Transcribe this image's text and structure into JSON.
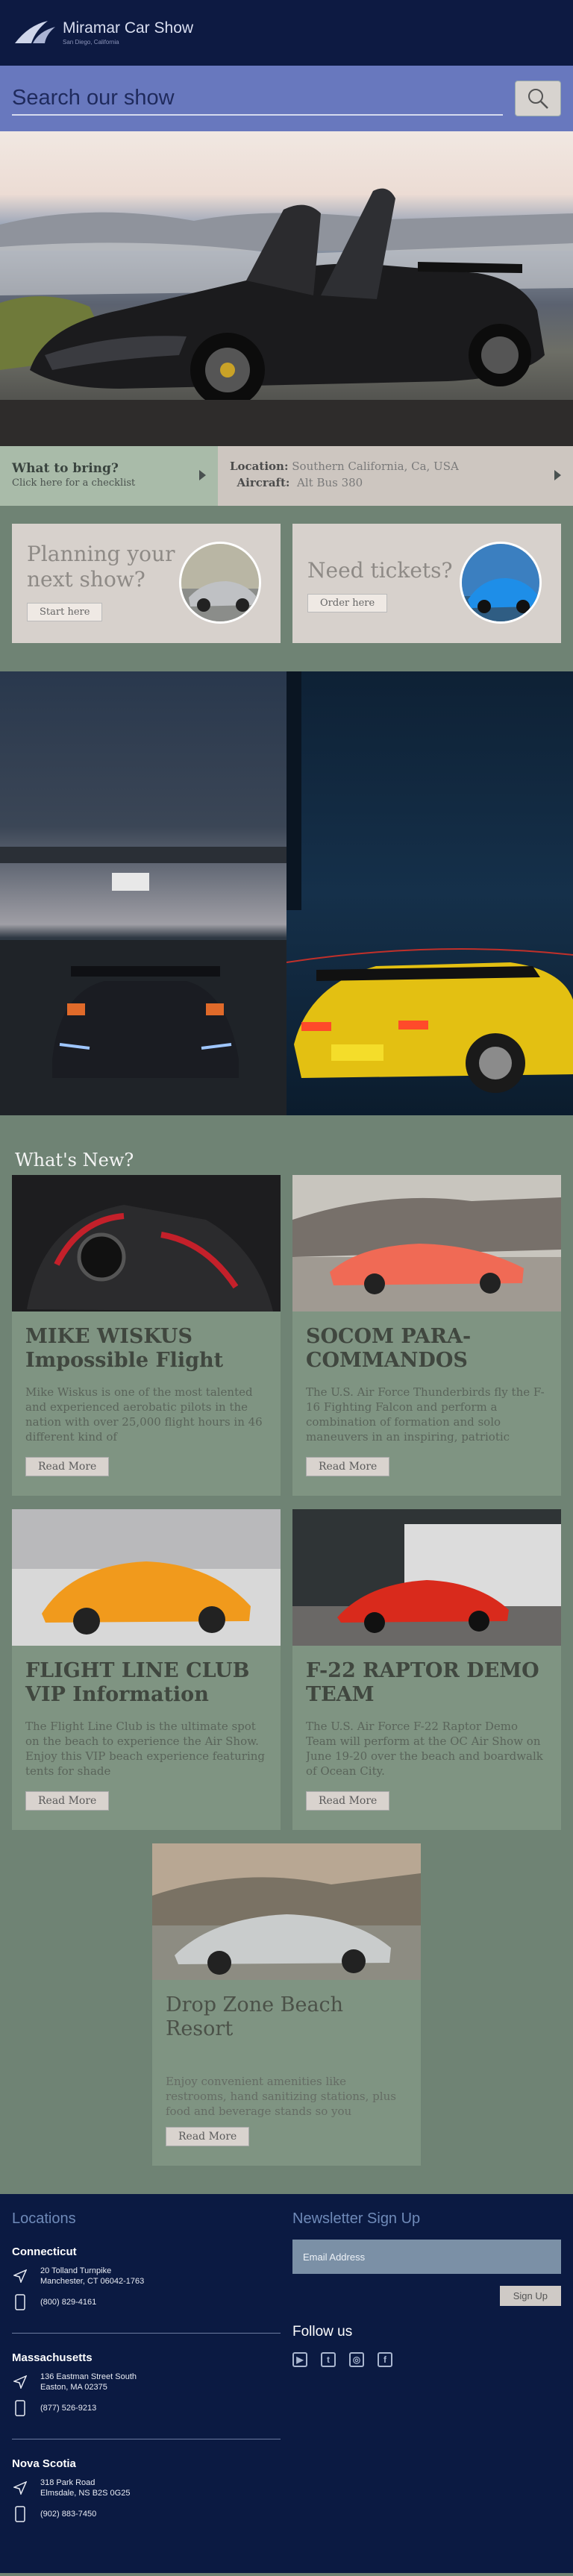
{
  "header": {
    "brand": "Miramar Car Show",
    "location_sub": "San Diego, California"
  },
  "search": {
    "placeholder": "Search our show",
    "icon": "search-icon"
  },
  "info": {
    "bring_title": "What to bring?",
    "bring_sub": "Click here for a checklist",
    "location_label": "Location:",
    "location_value": "Southern California, Ca, USA",
    "aircraft_label": "Aircraft:",
    "aircraft_value": "Alt Bus 380"
  },
  "promos": [
    {
      "title": "Planning your next show?",
      "button": "Start here"
    },
    {
      "title": "Need tickets?",
      "button": "Order here"
    }
  ],
  "news": {
    "heading": "What's New?",
    "items": [
      {
        "title": "MIKE WISKUS Impossible Flight",
        "text": "Mike Wiskus is one of the most talented and experienced aerobatic pilots in the nation with over 25,000 flight hours in 46 different kind of",
        "button": "Read More"
      },
      {
        "title": "SOCOM PARA-COMMANDOS",
        "text": "The U.S. Air Force Thunderbirds fly the F-16 Fighting Falcon and perform a combination of formation and solo maneuvers in an inspiring, patriotic",
        "button": "Read More"
      },
      {
        "title": "FLIGHT LINE CLUB VIP Information",
        "text": "The Flight Line Club is the ultimate spot on the beach to experience the Air Show. Enjoy this VIP beach experience featuring tents for shade",
        "button": "Read More"
      },
      {
        "title": "F-22 RAPTOR DEMO TEAM",
        "text": "The U.S. Air Force F-22 Raptor Demo Team will perform at the OC Air Show on June 19-20 over the beach and boardwalk of Ocean City.",
        "button": "Read More"
      },
      {
        "title": "Drop Zone Beach Resort",
        "text": "Enjoy convenient amenities like restrooms, hand sanitizing stations, plus food and beverage stands so you",
        "button": "Read More"
      }
    ]
  },
  "footer": {
    "locations_heading": "Locations",
    "regions": [
      {
        "name": "Connecticut",
        "address1": "20 Tolland Turnpike",
        "address2": "Manchester, CT 06042-1763",
        "phone": "(800) 829-4161"
      },
      {
        "name": "Massachusetts",
        "address1": "136 Eastman Street South",
        "address2": "Easton, MA 02375",
        "phone": "(877)  526-9213"
      },
      {
        "name": "Nova Scotia",
        "address1": "318 Park Road",
        "address2": "Elmsdale, NS B2S 0G25",
        "phone": "(902) 883-7450"
      }
    ],
    "newsletter_heading": "Newsletter Sign Up",
    "email_placeholder": "Email Address",
    "signup_button": "Sign Up",
    "follow_heading": "Follow us"
  },
  "colors": {
    "header_bg": "#0d1a42",
    "search_bg": "#6878be",
    "page_bg": "#6f8374",
    "card_bg": "#7f9482",
    "footer_bg": "#0b1a42"
  }
}
